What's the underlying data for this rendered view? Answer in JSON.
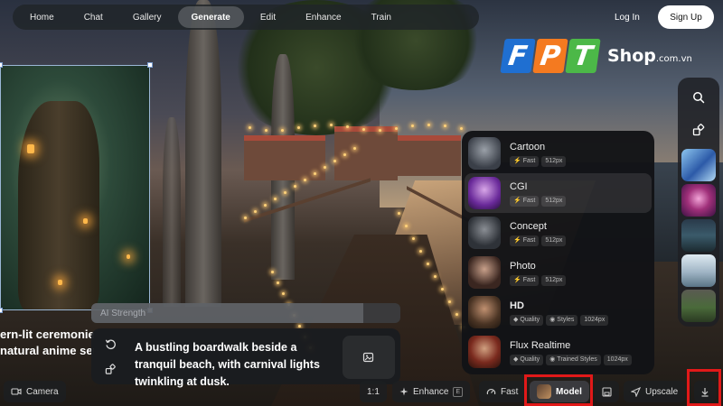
{
  "nav": {
    "tabs": [
      "Home",
      "Chat",
      "Gallery",
      "Generate",
      "Edit",
      "Enhance",
      "Train"
    ],
    "active": "Generate",
    "login_label": "Log In",
    "signup_label": "Sign Up"
  },
  "watermark": {
    "letters": [
      "F",
      "P",
      "T"
    ],
    "shop_text": "Shop",
    "domain_text": ".com.vn"
  },
  "canvas": {
    "left_caption_line1": "ern-lit ceremonies",
    "left_caption_line2": "natural anime set"
  },
  "model_panel": {
    "models": [
      {
        "name": "Cartoon",
        "tags": [
          "Fast",
          "512px"
        ],
        "tag_icons": [
          "bolt-icon"
        ]
      },
      {
        "name": "CGI",
        "tags": [
          "Fast",
          "512px"
        ],
        "tag_icons": [
          "bolt-icon"
        ]
      },
      {
        "name": "Concept",
        "tags": [
          "Fast",
          "512px"
        ],
        "tag_icons": [
          "bolt-icon"
        ]
      },
      {
        "name": "Photo",
        "tags": [
          "Fast",
          "512px"
        ],
        "tag_icons": [
          "bolt-icon"
        ]
      },
      {
        "name": "HD",
        "tags": [
          "Quality",
          "Styles",
          "1024px"
        ],
        "tag_icons": [
          "diamond-icon",
          "palette-icon"
        ]
      },
      {
        "name": "Flux Realtime",
        "tags": [
          "Quality",
          "Trained Styles",
          "1024px"
        ],
        "tag_icons": [
          "diamond-icon",
          "palette-icon"
        ]
      }
    ],
    "selected_index": 1
  },
  "strength": {
    "label": "AI Strength",
    "value_fraction": 0.88
  },
  "prompt": {
    "text": "A bustling boardwalk beside a tranquil beach, with carnival lights twinkling at dusk."
  },
  "toolbar": {
    "camera_label": "Camera",
    "ratio_label": "1:1",
    "enhance_label": "Enhance",
    "enhance_key": "E",
    "fast_label": "Fast",
    "model_label": "Model",
    "upscale_label": "Upscale"
  },
  "colors": {
    "highlight": "#e11919",
    "fpt_blue": "#1f6fd1",
    "fpt_orange": "#f47a20",
    "fpt_green": "#4cb848"
  }
}
